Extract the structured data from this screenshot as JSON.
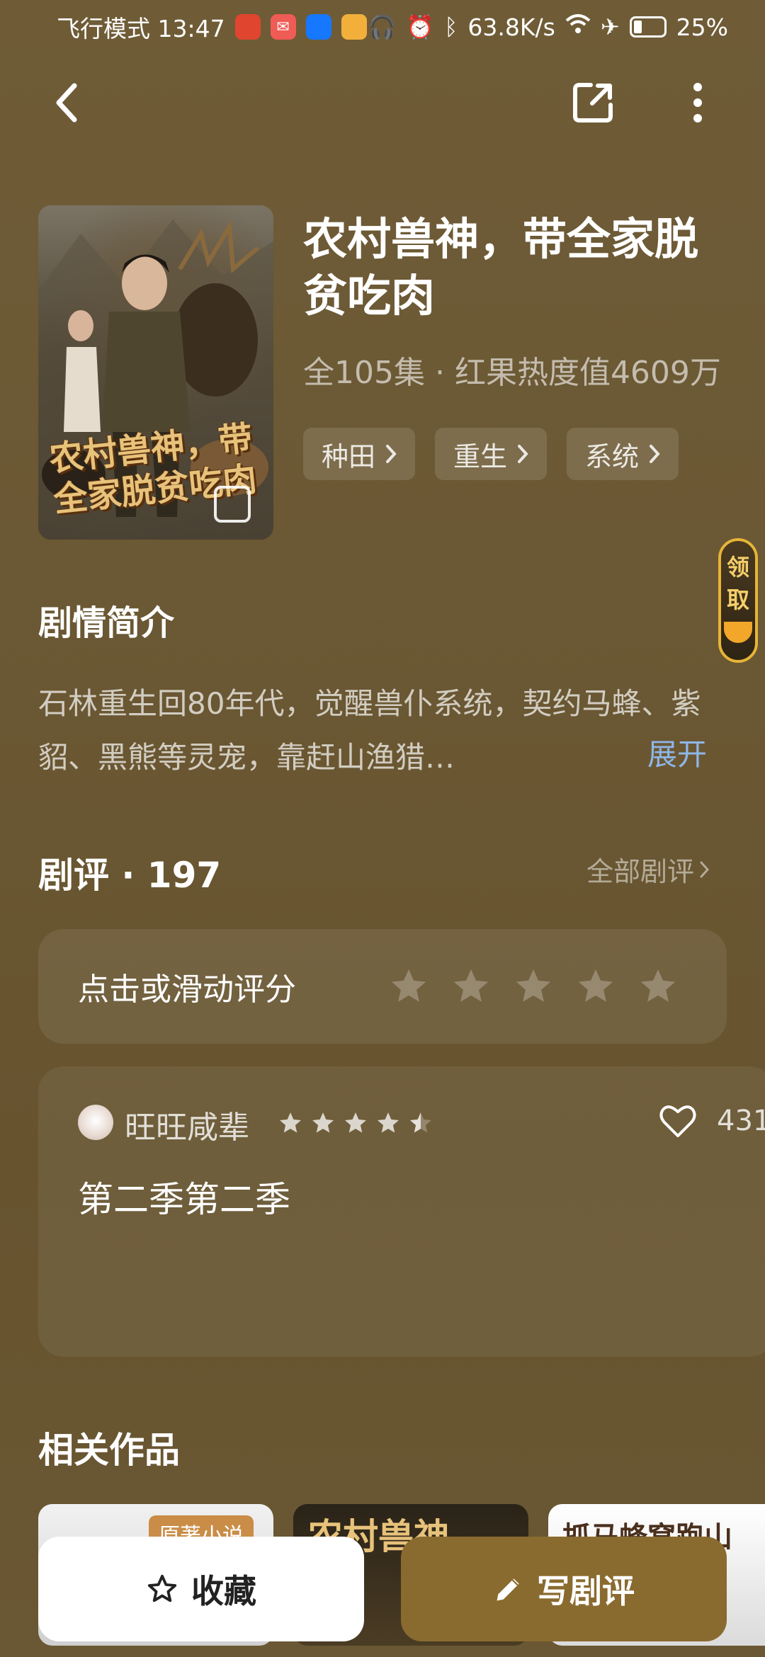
{
  "status_bar": {
    "left_text": "飞行模式 13:47",
    "network_speed": "63.8K/s",
    "battery": "25%"
  },
  "show": {
    "title": "农村兽神，带全家脱贫吃肉",
    "meta": "全105集 · 红果热度值4609万",
    "tags": [
      "种田",
      "重生",
      "系统"
    ],
    "cover_title": "农村兽神，带全家脱贫吃肉"
  },
  "coupon": {
    "line1": "领",
    "line2": "取"
  },
  "synopsis": {
    "heading": "剧情简介",
    "text": "石林重生回80年代，觉醒兽仆系统，契约马蜂、紫貂、黑熊等灵宠，靠赶山渔猎…",
    "expand": "展开"
  },
  "reviews": {
    "heading": "剧评 · 197",
    "all_label": "全部剧评",
    "rate_prompt": "点击或滑动评分",
    "item": {
      "user": "旺旺咸辈",
      "rating": 4.5,
      "likes": "431",
      "text": "第二季第二季"
    }
  },
  "related": {
    "heading": "相关作品",
    "items": [
      {
        "badge": "原著小说"
      },
      {
        "label": "农村兽神"
      },
      {
        "label": "抓马蜂窝跑山"
      }
    ]
  },
  "actions": {
    "favorite": "收藏",
    "write_review": "写剧评"
  },
  "colors": {
    "background": "#6f5c37",
    "accent_button": "#8a6b2f",
    "link": "#8fb6e9"
  },
  "icons": [
    "back-arrow-icon",
    "share-icon",
    "more-icon",
    "chevron-right-icon",
    "star-icon",
    "heart-icon",
    "pencil-icon"
  ]
}
